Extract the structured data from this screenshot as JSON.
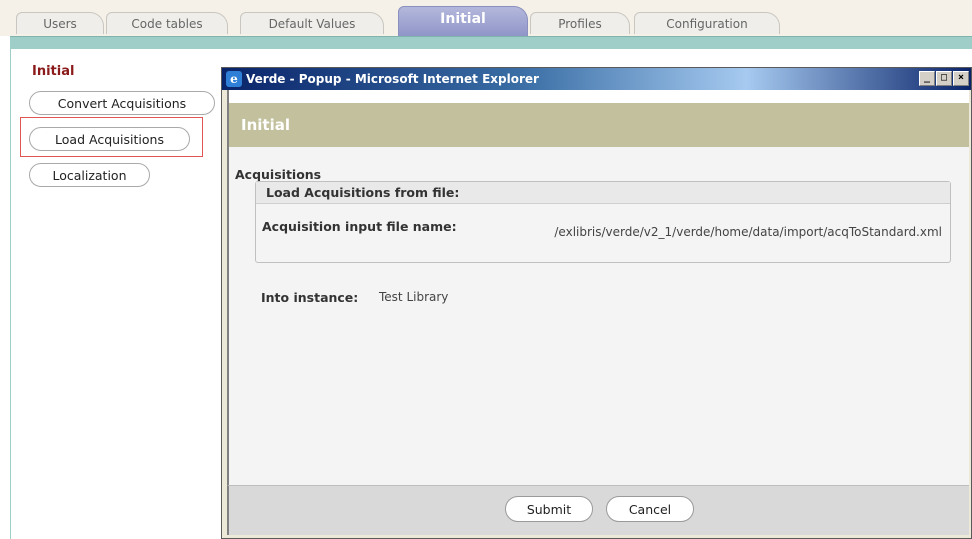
{
  "tabs": [
    {
      "label": "Users"
    },
    {
      "label": "Code tables"
    },
    {
      "label": "Default Values"
    },
    {
      "label": "Initial",
      "active": true
    },
    {
      "label": "Profiles"
    },
    {
      "label": "Configuration"
    }
  ],
  "sidebar": {
    "title": "Initial",
    "items": [
      {
        "label": "Convert Acquisitions"
      },
      {
        "label": "Load Acquisitions",
        "highlighted": true
      },
      {
        "label": "Localization"
      }
    ]
  },
  "popup": {
    "window_title": "Verde - Popup - Microsoft Internet Explorer",
    "window_buttons": {
      "minimize": "_",
      "maximize": "□",
      "close": "×"
    },
    "header": "Initial",
    "section": "Acquisitions",
    "fieldset_legend": "Load Acquisitions from file:",
    "input_file_label": "Acquisition input file name:",
    "input_file_value": "/exlibris/verde/v2_1/verde/home/data/import/acqToStandard.xml",
    "instance_label": "Into instance:",
    "instance_value": "Test Library",
    "submit_label": "Submit",
    "cancel_label": "Cancel"
  },
  "colors": {
    "active_tab": "#8f95c8",
    "teal_band": "#9fcdc8",
    "popup_header": "#c3c19d",
    "nav_title": "#8b1a1a",
    "highlight": "#e05555"
  }
}
